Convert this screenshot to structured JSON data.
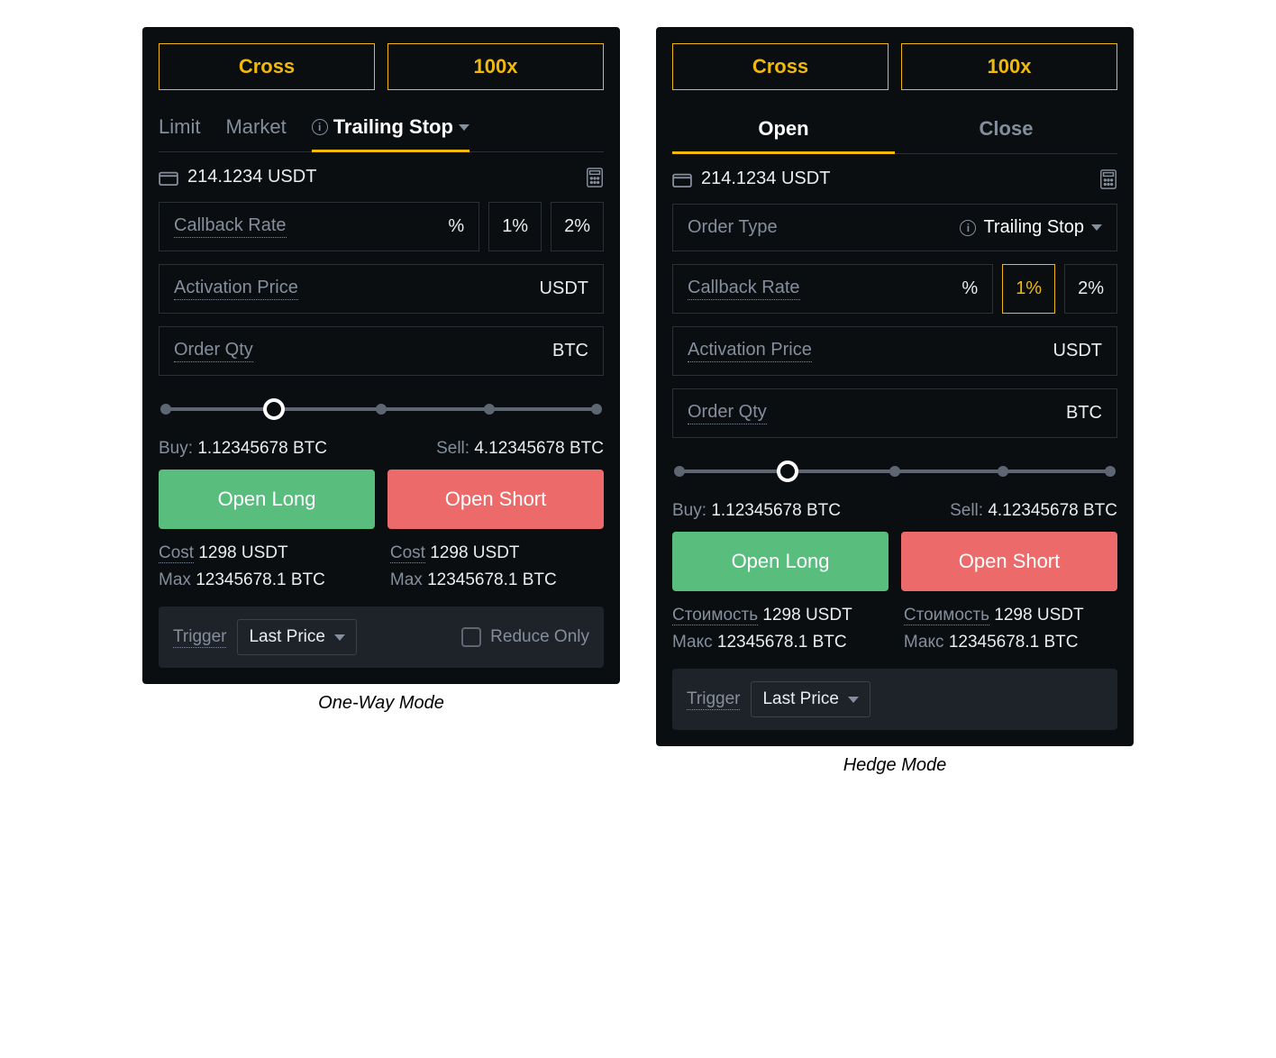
{
  "left": {
    "caption": "One-Way Mode",
    "margin_mode": "Cross",
    "leverage": "100x",
    "tabs": [
      "Limit",
      "Market",
      "Trailing Stop"
    ],
    "active_tab": "Trailing Stop",
    "balance": "214.1234 USDT",
    "callback_label": "Callback Rate",
    "callback_unit": "%",
    "pct_buttons": [
      "1%",
      "2%"
    ],
    "activation_label": "Activation Price",
    "activation_unit": "USDT",
    "qty_label": "Order Qty",
    "qty_unit": "BTC",
    "buy_label": "Buy:",
    "buy_value": "1.12345678 BTC",
    "sell_label": "Sell:",
    "sell_value": "4.12345678 BTC",
    "open_long": "Open Long",
    "open_short": "Open Short",
    "cost_label": "Cost",
    "cost_value_left": "1298 USDT",
    "cost_value_right": "1298 USDT",
    "max_label": "Max",
    "max_value_left": "12345678.1 BTC",
    "max_value_right": "12345678.1 BTC",
    "trigger_label": "Trigger",
    "trigger_value": "Last Price",
    "reduce_only": "Reduce Only"
  },
  "right": {
    "caption": "Hedge Mode",
    "margin_mode": "Cross",
    "leverage": "100x",
    "tabs": [
      "Open",
      "Close"
    ],
    "active_tab": "Open",
    "balance": "214.1234 USDT",
    "order_type_label": "Order Type",
    "order_type_value": "Trailing Stop",
    "callback_label": "Callback Rate",
    "callback_unit": "%",
    "pct_buttons": [
      "1%",
      "2%"
    ],
    "pct_active": "1%",
    "activation_label": "Activation Price",
    "activation_unit": "USDT",
    "qty_label": "Order Qty",
    "qty_unit": "BTC",
    "buy_label": "Buy:",
    "buy_value": "1.12345678 BTC",
    "sell_label": "Sell:",
    "sell_value": "4.12345678 BTC",
    "open_long": "Open Long",
    "open_short": "Open Short",
    "cost_label": "Стоимость",
    "cost_value_left": "1298 USDT",
    "cost_value_right": "1298 USDT",
    "max_label": "Макс",
    "max_value_left": "12345678.1 BTC",
    "max_value_right": "12345678.1 BTC",
    "trigger_label": "Trigger",
    "trigger_value": "Last Price"
  }
}
